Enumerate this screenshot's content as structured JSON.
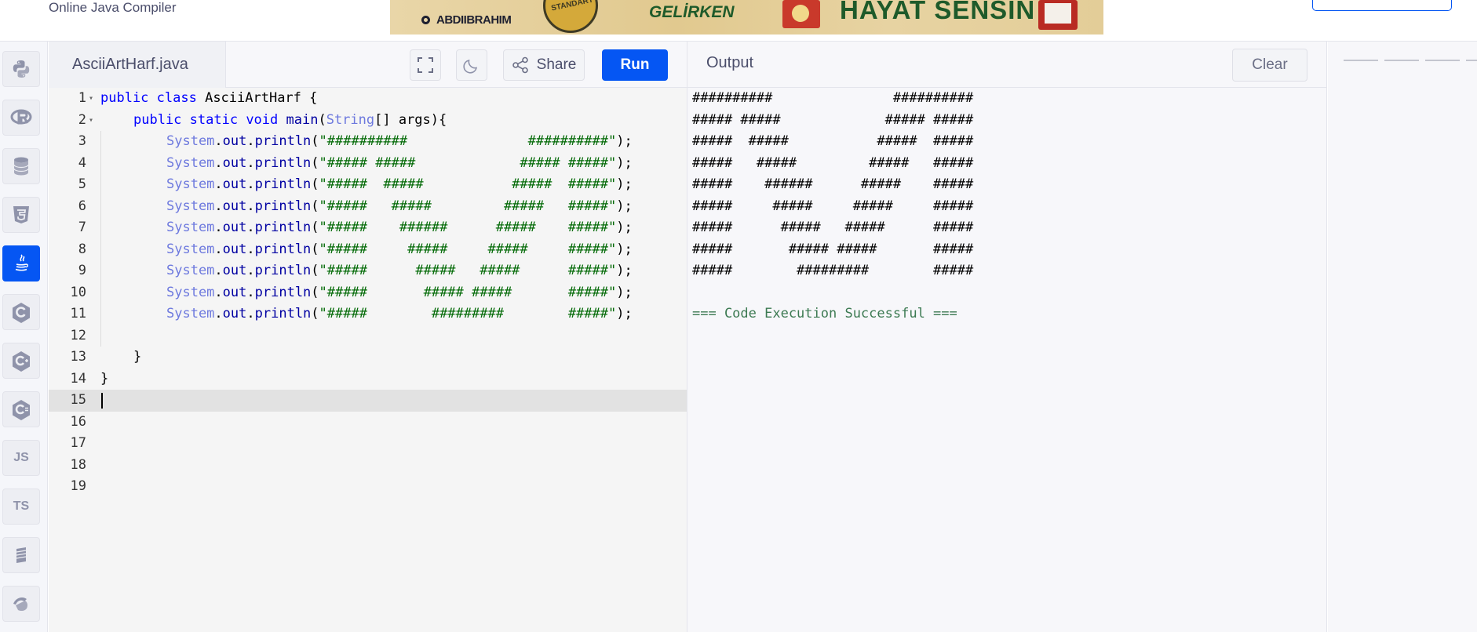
{
  "header": {
    "brand": "Online Java Compiler",
    "ad": {
      "brand": "ABDIIBRAHIM",
      "badge": "STANDART",
      "tagline_left": "GELİRKEN",
      "tagline_right": "HAYAT SENSİN"
    }
  },
  "sidebar": {
    "items": [
      {
        "name": "python-icon",
        "label": ""
      },
      {
        "name": "r-icon",
        "label": ""
      },
      {
        "name": "sql-icon",
        "label": ""
      },
      {
        "name": "html5-icon",
        "label": ""
      },
      {
        "name": "java-icon",
        "label": ""
      },
      {
        "name": "c-icon",
        "label": ""
      },
      {
        "name": "cpp-icon",
        "label": ""
      },
      {
        "name": "csharp-icon",
        "label": ""
      },
      {
        "name": "js-icon",
        "label": "JS"
      },
      {
        "name": "ts-icon",
        "label": "TS"
      },
      {
        "name": "go-icon",
        "label": ""
      },
      {
        "name": "php-icon",
        "label": ""
      }
    ],
    "active": "java-icon"
  },
  "editor": {
    "filename": "AsciiArtHarf.java",
    "share_label": "Share",
    "run_label": "Run",
    "active_line": 15,
    "lines": [
      {
        "n": "1",
        "fold": true,
        "indent": 0,
        "tokens": [
          [
            "kw",
            "public "
          ],
          [
            "kw",
            "class "
          ],
          [
            "plain",
            "AsciiArtHarf {"
          ]
        ]
      },
      {
        "n": "2",
        "fold": true,
        "indent": 1,
        "tokens": [
          [
            "kw",
            "public "
          ],
          [
            "kw",
            "static "
          ],
          [
            "kw",
            "void "
          ],
          [
            "fn",
            "main"
          ],
          [
            "plain",
            "("
          ],
          [
            "cls",
            "String"
          ],
          [
            "plain",
            "[] args){"
          ]
        ]
      },
      {
        "n": "3",
        "fold": false,
        "indent": 2,
        "tokens": [
          [
            "cls",
            "System"
          ],
          [
            "plain",
            "."
          ],
          [
            "fn",
            "out"
          ],
          [
            "plain",
            "."
          ],
          [
            "fn",
            "println"
          ],
          [
            "plain",
            "("
          ],
          [
            "str",
            "\"##########               ##########\""
          ],
          [
            "plain",
            ");"
          ]
        ]
      },
      {
        "n": "4",
        "fold": false,
        "indent": 2,
        "tokens": [
          [
            "cls",
            "System"
          ],
          [
            "plain",
            "."
          ],
          [
            "fn",
            "out"
          ],
          [
            "plain",
            "."
          ],
          [
            "fn",
            "println"
          ],
          [
            "plain",
            "("
          ],
          [
            "str",
            "\"##### #####             ##### #####\""
          ],
          [
            "plain",
            ");"
          ]
        ]
      },
      {
        "n": "5",
        "fold": false,
        "indent": 2,
        "tokens": [
          [
            "cls",
            "System"
          ],
          [
            "plain",
            "."
          ],
          [
            "fn",
            "out"
          ],
          [
            "plain",
            "."
          ],
          [
            "fn",
            "println"
          ],
          [
            "plain",
            "("
          ],
          [
            "str",
            "\"#####  #####           #####  #####\""
          ],
          [
            "plain",
            ");"
          ]
        ]
      },
      {
        "n": "6",
        "fold": false,
        "indent": 2,
        "tokens": [
          [
            "cls",
            "System"
          ],
          [
            "plain",
            "."
          ],
          [
            "fn",
            "out"
          ],
          [
            "plain",
            "."
          ],
          [
            "fn",
            "println"
          ],
          [
            "plain",
            "("
          ],
          [
            "str",
            "\"#####   #####         #####   #####\""
          ],
          [
            "plain",
            ");"
          ]
        ]
      },
      {
        "n": "7",
        "fold": false,
        "indent": 2,
        "tokens": [
          [
            "cls",
            "System"
          ],
          [
            "plain",
            "."
          ],
          [
            "fn",
            "out"
          ],
          [
            "plain",
            "."
          ],
          [
            "fn",
            "println"
          ],
          [
            "plain",
            "("
          ],
          [
            "str",
            "\"#####    ######      #####    #####\""
          ],
          [
            "plain",
            ");"
          ]
        ]
      },
      {
        "n": "8",
        "fold": false,
        "indent": 2,
        "tokens": [
          [
            "cls",
            "System"
          ],
          [
            "plain",
            "."
          ],
          [
            "fn",
            "out"
          ],
          [
            "plain",
            "."
          ],
          [
            "fn",
            "println"
          ],
          [
            "plain",
            "("
          ],
          [
            "str",
            "\"#####     #####     #####     #####\""
          ],
          [
            "plain",
            ");"
          ]
        ]
      },
      {
        "n": "9",
        "fold": false,
        "indent": 2,
        "tokens": [
          [
            "cls",
            "System"
          ],
          [
            "plain",
            "."
          ],
          [
            "fn",
            "out"
          ],
          [
            "plain",
            "."
          ],
          [
            "fn",
            "println"
          ],
          [
            "plain",
            "("
          ],
          [
            "str",
            "\"#####      #####   #####      #####\""
          ],
          [
            "plain",
            ");"
          ]
        ]
      },
      {
        "n": "10",
        "fold": false,
        "indent": 2,
        "tokens": [
          [
            "cls",
            "System"
          ],
          [
            "plain",
            "."
          ],
          [
            "fn",
            "out"
          ],
          [
            "plain",
            "."
          ],
          [
            "fn",
            "println"
          ],
          [
            "plain",
            "("
          ],
          [
            "str",
            "\"#####       ##### #####       #####\""
          ],
          [
            "plain",
            ");"
          ]
        ]
      },
      {
        "n": "11",
        "fold": false,
        "indent": 2,
        "tokens": [
          [
            "cls",
            "System"
          ],
          [
            "plain",
            "."
          ],
          [
            "fn",
            "out"
          ],
          [
            "plain",
            "."
          ],
          [
            "fn",
            "println"
          ],
          [
            "plain",
            "("
          ],
          [
            "str",
            "\"#####        #########        #####\""
          ],
          [
            "plain",
            ");"
          ]
        ]
      },
      {
        "n": "12",
        "fold": false,
        "indent": 2,
        "tokens": []
      },
      {
        "n": "13",
        "fold": false,
        "indent": 1,
        "tokens": [
          [
            "plain",
            "}"
          ]
        ]
      },
      {
        "n": "14",
        "fold": false,
        "indent": 0,
        "tokens": [
          [
            "plain",
            "}"
          ]
        ]
      },
      {
        "n": "15",
        "fold": false,
        "indent": 0,
        "tokens": []
      },
      {
        "n": "16",
        "fold": false,
        "indent": 0,
        "tokens": []
      },
      {
        "n": "17",
        "fold": false,
        "indent": 0,
        "tokens": []
      },
      {
        "n": "18",
        "fold": false,
        "indent": 0,
        "tokens": []
      },
      {
        "n": "19",
        "fold": false,
        "indent": 0,
        "tokens": []
      }
    ]
  },
  "output": {
    "title": "Output",
    "clear_label": "Clear",
    "lines": [
      "##########               ##########",
      "##### #####             ##### #####",
      "#####  #####           #####  #####",
      "#####   #####         #####   #####",
      "#####    ######      #####    #####",
      "#####     #####     #####     #####",
      "#####      #####   #####      #####",
      "#####       ##### #####       #####",
      "#####        #########        #####",
      ""
    ],
    "status": "=== Code Execution Successful ==="
  },
  "colors": {
    "accent": "#0556f3",
    "keyword": "#0000ff",
    "string": "#036a07",
    "success": "#3c7a52"
  }
}
